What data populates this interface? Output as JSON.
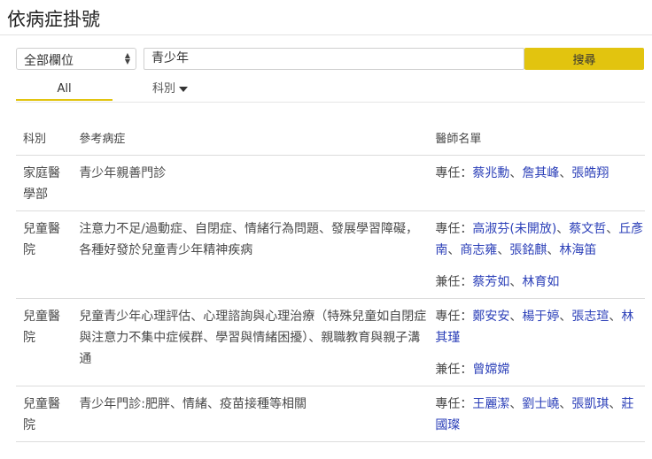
{
  "page": {
    "title": "依病症掛號"
  },
  "search": {
    "field_selected": "全部欄位",
    "keyword_value": "青少年",
    "button_label": "搜尋"
  },
  "tabs": [
    {
      "label": "All",
      "active": true
    },
    {
      "label": "科別",
      "dropdown": true
    }
  ],
  "table": {
    "headers": {
      "dept": "科別",
      "condition": "參考病症",
      "doctors": "醫師名單"
    },
    "rows": [
      {
        "dept": "家庭醫學部",
        "condition": "青少年親善門診",
        "roles": [
          {
            "label": "專任：",
            "doctors": [
              "蔡兆勳",
              "詹其峰",
              "張皓翔"
            ]
          }
        ]
      },
      {
        "dept": "兒童醫院",
        "condition": "注意力不足/過動症、自閉症、情緒行為問題、發展學習障礙，各種好發於兒童青少年精神疾病",
        "roles": [
          {
            "label": "專任：",
            "doctors": [
              "高淑芬(未開放)",
              "蔡文哲",
              "丘彥南",
              "商志雍",
              "張銘麒",
              "林海笛"
            ]
          },
          {
            "label": "兼任：",
            "doctors": [
              "蔡芳如",
              "林育如"
            ]
          }
        ]
      },
      {
        "dept": "兒童醫院",
        "condition": "兒童青少年心理評估、心理諮詢與心理治療（特殊兒童如自閉症與注意力不集中症候群、學習與情緒困擾）、親職教育與親子溝通",
        "roles": [
          {
            "label": "專任：",
            "doctors": [
              "鄭安安",
              "楊于婷",
              "張志瑄",
              "林其瑾"
            ]
          },
          {
            "label": "兼任：",
            "doctors": [
              "曾嫦嫦"
            ]
          }
        ]
      },
      {
        "dept": "兒童醫院",
        "condition": "青少年門診:肥胖、情緒、疫苗接種等相關",
        "roles": [
          {
            "label": "專任：",
            "doctors": [
              "王麗潔",
              "劉士嶢",
              "張凱琪",
              "莊國璨"
            ]
          }
        ]
      }
    ]
  },
  "colors": {
    "accent": "#e2c40f",
    "link": "#2b3fb8"
  }
}
